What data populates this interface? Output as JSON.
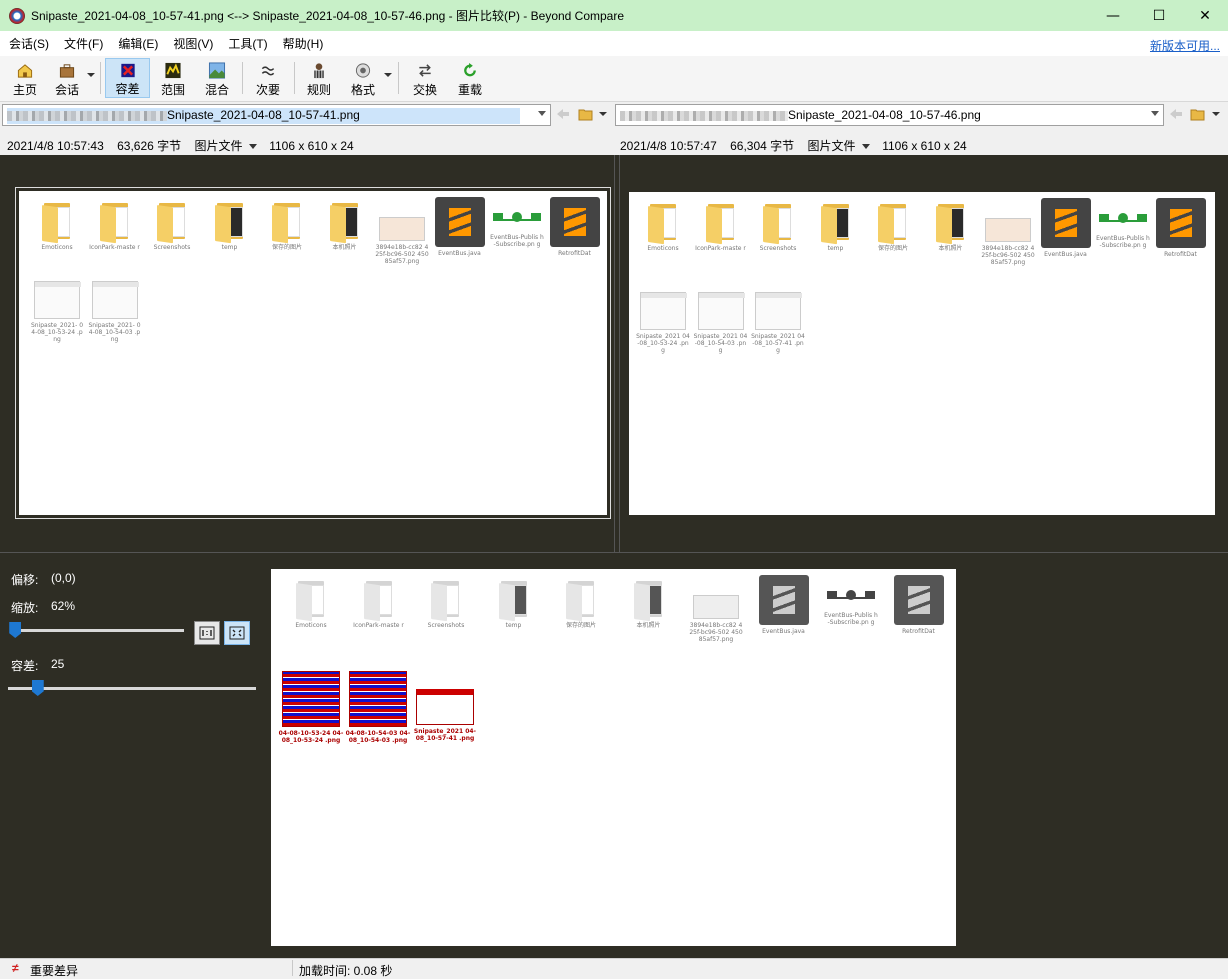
{
  "window": {
    "title": "Snipaste_2021-04-08_10-57-41.png <--> Snipaste_2021-04-08_10-57-46.png - 图片比较(P) - Beyond Compare",
    "minimize": "—",
    "maximize": "☐",
    "close": "✕"
  },
  "menu": {
    "items": [
      "会话(S)",
      "文件(F)",
      "编辑(E)",
      "视图(V)",
      "工具(T)",
      "帮助(H)"
    ],
    "new_version": "新版本可用..."
  },
  "toolbar": {
    "home": "主页",
    "session": "会话",
    "tolerance": "容差",
    "range": "范围",
    "blend": "混合",
    "minor": "次要",
    "rules": "规则",
    "format": "格式",
    "swap": "交换",
    "reload": "重载"
  },
  "left": {
    "path": "Snipaste_2021-04-08_10-57-41.png",
    "info": {
      "date": "2021/4/8 10:57:43",
      "size": "63,626 字节",
      "type": "图片文件",
      "dims": "1106 x 610 x 24"
    }
  },
  "right": {
    "path": "Snipaste_2021-04-08_10-57-46.png",
    "info": {
      "date": "2021/4/8 10:57:47",
      "size": "66,304 字节",
      "type": "图片文件",
      "dims": "1106 x 610 x 24"
    }
  },
  "thumbs": {
    "row1": [
      "Emoticons",
      "IconPark-maste r",
      "Screenshots",
      "temp",
      "保存的图片",
      "本机照片",
      "3894e18b-cc82 425f-bc96-502 45085af57.png",
      "EventBus.java",
      "EventBus-Publis h-Subscribe.pn g",
      "RetrofitDat"
    ],
    "left_row2": [
      "Snipaste_2021- 04-08_10-53-24 .png",
      "Snipaste_2021- 04-08_10-54-03 .png"
    ],
    "right_row2": [
      "Snipaste_2021 04-08_10-53-24 .png",
      "Snipaste_2021 04-08_10-54-03 .png",
      "Snipaste_2021 04-08_10-57-41 .png"
    ],
    "diff_row2": [
      "04-08-10-53-24 04-08_10-53-24 .png",
      "04-08-10-54-03 04-08_10-54-03 .png",
      "Snipaste_2021 04-08_10-57-41 .png"
    ]
  },
  "controls": {
    "offset_label": "偏移:",
    "offset_value": "(0,0)",
    "zoom_label": "缩放:",
    "zoom_value": "62%",
    "tolerance_label": "容差:",
    "tolerance_value": "25",
    "zoom_fraction": 0.03,
    "tolerance_fraction": 0.12
  },
  "status": {
    "diff": "重要差异",
    "load_time": "加载时间: 0.08 秒"
  },
  "colors": {
    "title_bg": "#c8f0c8",
    "dark_bg": "#2e2d24",
    "accent": "#1e78d2",
    "diff_red": "#cc0000",
    "diff_blue": "#1010cc"
  }
}
